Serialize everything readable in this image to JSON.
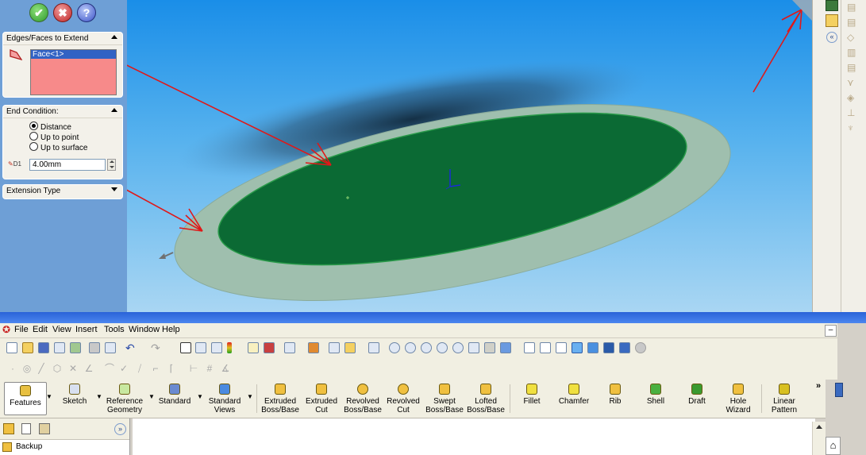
{
  "property_manager": {
    "ok_icon": "check-icon",
    "cancel_icon": "x-icon",
    "help_icon": "question-icon",
    "edges_group": {
      "title": "Edges/Faces to Extend",
      "selection": "Face<1>"
    },
    "end_condition": {
      "title": "End Condition:",
      "options": [
        "Distance",
        "Up to point",
        "Up to surface"
      ],
      "selected": "Distance",
      "distance_value": "4.00mm",
      "distance_label": "D1"
    },
    "extension_type": {
      "title": "Extension Type"
    }
  },
  "menu": {
    "items": [
      "File",
      "Edit",
      "View",
      "Insert",
      "Tools",
      "Window",
      "Help"
    ]
  },
  "command_manager": {
    "tabs": [
      {
        "label": "Features"
      },
      {
        "label": "Sketch"
      },
      {
        "label": "Reference Geometry"
      },
      {
        "label": "Standard"
      },
      {
        "label": "Standard Views"
      }
    ],
    "features": [
      {
        "label": "Extruded Boss/Base"
      },
      {
        "label": "Extruded Cut"
      },
      {
        "label": "Revolved Boss/Base"
      },
      {
        "label": "Revolved Cut"
      },
      {
        "label": "Swept Boss/Base"
      },
      {
        "label": "Lofted Boss/Base"
      },
      {
        "label": "Fillet"
      },
      {
        "label": "Chamfer"
      },
      {
        "label": "Rib"
      },
      {
        "label": "Shell"
      },
      {
        "label": "Draft"
      },
      {
        "label": "Hole Wizard"
      },
      {
        "label": "Linear Pattern"
      }
    ],
    "overflow": "»"
  },
  "feature_tree": {
    "collapse": "»",
    "first_item": "Backup"
  },
  "colors": {
    "face_green": "#0b6a34",
    "surface_extension": "#9fbfae",
    "arrow_red": "#e01818",
    "selection_pink": "#f88a8a"
  }
}
